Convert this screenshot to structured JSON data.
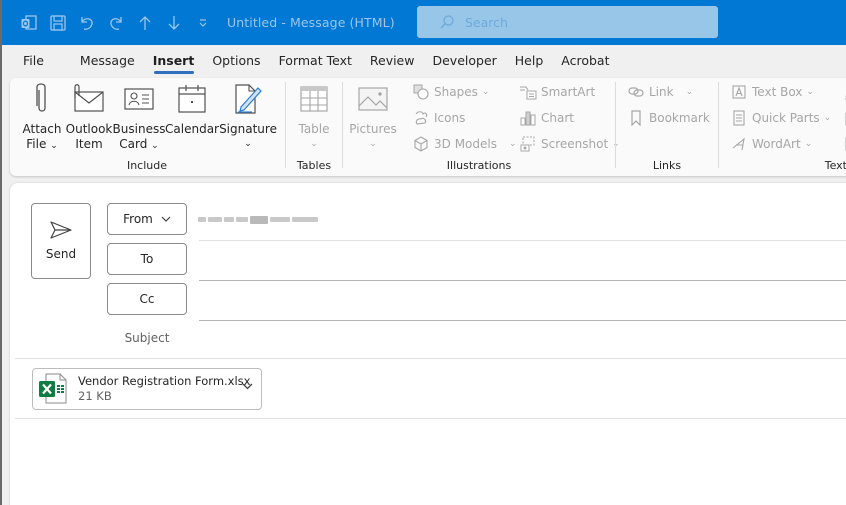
{
  "window": {
    "title": "Untitled  -  Message (HTML)",
    "search_placeholder": "Search",
    "quick_access": [
      "outlook-icon",
      "save-icon",
      "undo-icon",
      "redo-icon",
      "previous-item-icon",
      "next-item-icon",
      "customize-qat-icon"
    ]
  },
  "tabs": [
    {
      "label": "File"
    },
    {
      "label": "Message"
    },
    {
      "label": "Insert",
      "active": true
    },
    {
      "label": "Options"
    },
    {
      "label": "Format Text"
    },
    {
      "label": "Review"
    },
    {
      "label": "Developer"
    },
    {
      "label": "Help"
    },
    {
      "label": "Acrobat"
    }
  ],
  "ribbon": {
    "include": {
      "label": "Include",
      "attach_file": {
        "line1": "Attach",
        "line2": "File"
      },
      "outlook_item": {
        "line1": "Outlook",
        "line2": "Item"
      },
      "business_card": {
        "line1": "Business",
        "line2": "Card"
      },
      "calendar": {
        "line1": "Calendar"
      },
      "signature": {
        "line1": "Signature"
      }
    },
    "tables": {
      "label": "Tables",
      "table": "Table"
    },
    "illustrations": {
      "label": "Illustrations",
      "pictures": "Pictures",
      "shapes": "Shapes",
      "icons": "Icons",
      "models_3d": "3D Models",
      "smartart": "SmartArt",
      "chart": "Chart",
      "screenshot": "Screenshot"
    },
    "links": {
      "label": "Links",
      "link": "Link",
      "bookmark": "Bookmark"
    },
    "text": {
      "label": "Text",
      "text_box": "Text Box",
      "quick_parts": "Quick Parts",
      "wordart": "WordArt"
    }
  },
  "compose": {
    "send_label": "Send",
    "from_label": "From",
    "to_label": "To",
    "cc_label": "Cc",
    "subject_label": "Subject",
    "to_value": "",
    "cc_value": "",
    "subject_value": ""
  },
  "attachment": {
    "name": "Vendor Registration Form.xlsx",
    "size": "21 KB",
    "icon": "excel-file-icon",
    "accent": "#107c41"
  },
  "colors": {
    "titlebar": "#0078d4",
    "tab_underline": "#2f6fbf"
  }
}
